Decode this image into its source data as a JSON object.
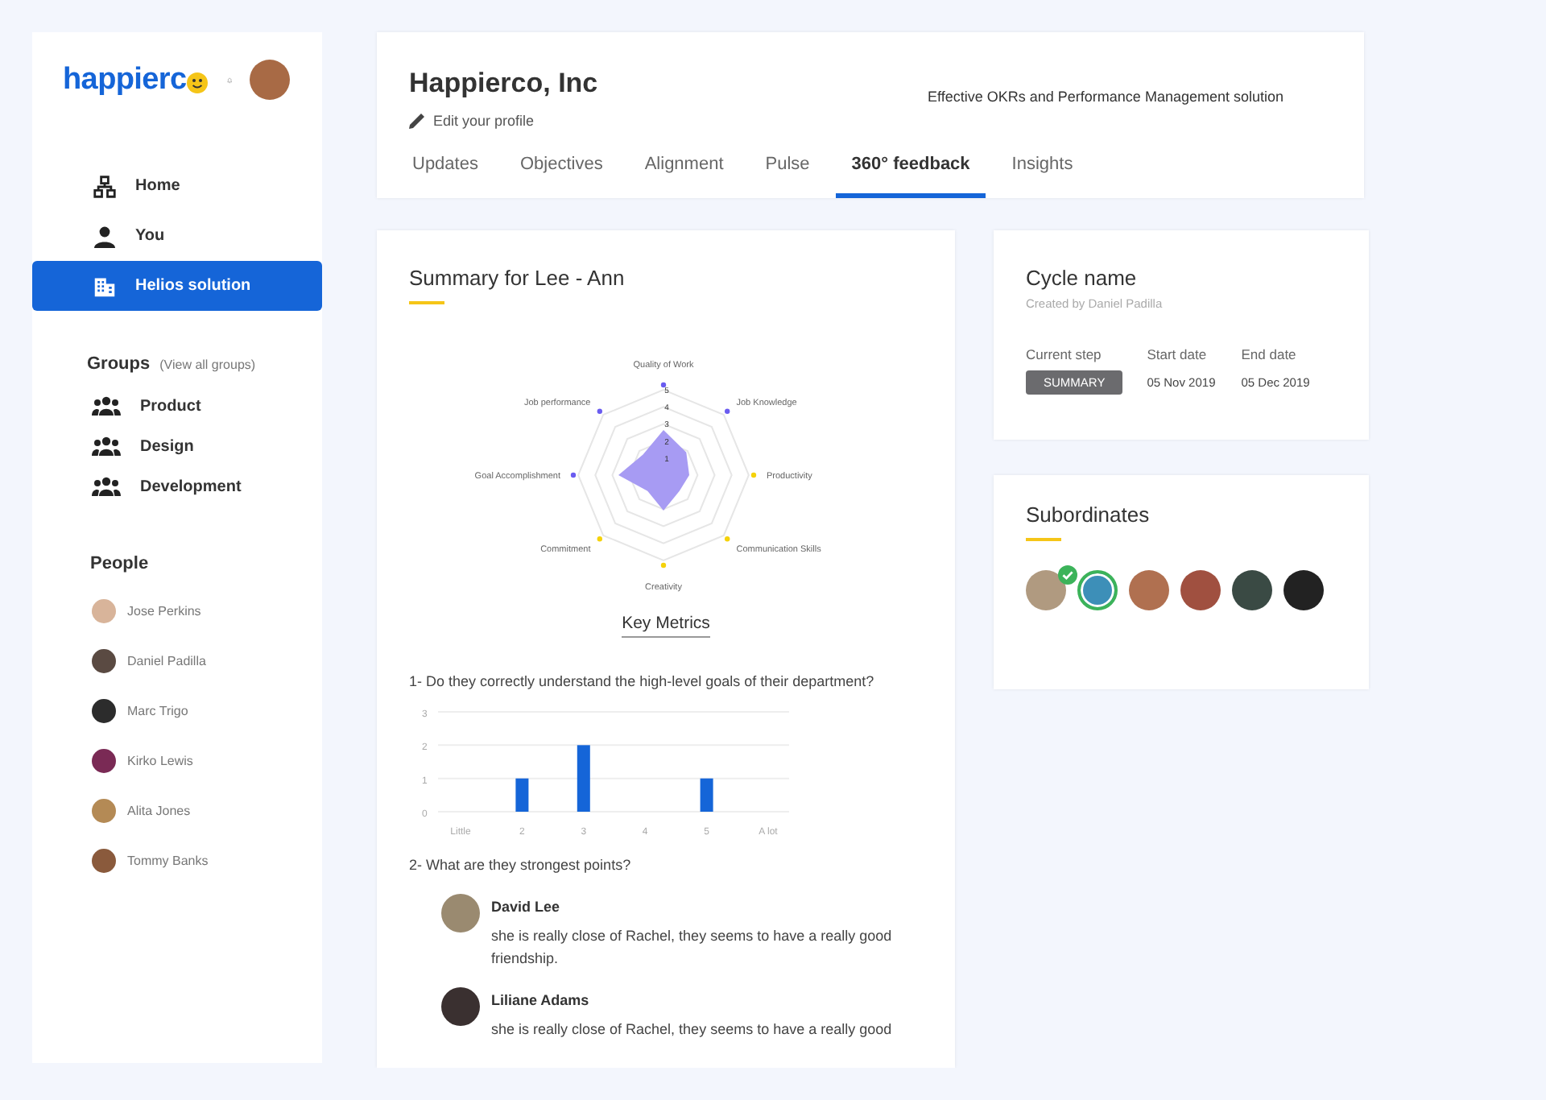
{
  "sidebar": {
    "logo": "happierc",
    "nav": [
      {
        "label": "Home",
        "selected": false
      },
      {
        "label": "You",
        "selected": false
      },
      {
        "label": "Helios solution",
        "selected": true
      }
    ],
    "groups_title": "Groups",
    "groups_link": "(View all groups)",
    "groups": [
      "Product",
      "Design",
      "Development"
    ],
    "people_title": "People",
    "people": [
      "Jose Perkins",
      "Daniel Padilla",
      "Marc Trigo",
      "Kirko Lewis",
      "Alita Jones",
      "Tommy Banks"
    ]
  },
  "header": {
    "company": "Happierco, Inc",
    "edit_link": "Edit your profile",
    "tagline": "Effective OKRs and Performance Management solution",
    "tabs": [
      {
        "label": "Updates",
        "selected": false
      },
      {
        "label": "Objectives",
        "selected": false
      },
      {
        "label": "Alignment",
        "selected": false
      },
      {
        "label": "Pulse",
        "selected": false
      },
      {
        "label": "360° feedback",
        "selected": true
      },
      {
        "label": "Insights",
        "selected": false
      }
    ]
  },
  "summary": {
    "title": "Summary for Lee - Ann",
    "radar": {
      "ticks": [
        "5",
        "4",
        "3",
        "2",
        "1"
      ],
      "axes": [
        {
          "label": "Quality of Work",
          "color": "#6a5cf0"
        },
        {
          "label": "Job Knowledge",
          "color": "#6a5cf0"
        },
        {
          "label": "Productivity",
          "color": "#f5d20a"
        },
        {
          "label": "Communication Skills",
          "color": "#f5d20a"
        },
        {
          "label": "Creativity",
          "color": "#f5d20a"
        },
        {
          "label": "Commitment",
          "color": "#f5d20a"
        },
        {
          "label": "Goal Accomplishment",
          "color": "#6a5cf0"
        },
        {
          "label": "Job performance",
          "color": "#6a5cf0"
        }
      ]
    },
    "metrics_title": "Key Metrics",
    "question_1": "1- Do they correctly understand the high-level goals of their department?",
    "chart_data": {
      "type": "bar",
      "categories": [
        "Little",
        "2",
        "3",
        "4",
        "5",
        "A lot"
      ],
      "series": [
        {
          "color": "#1565d8",
          "values": [
            null,
            1,
            2,
            0,
            1,
            null
          ]
        }
      ],
      "ylim": [
        0,
        3
      ],
      "yticks": [
        0,
        1,
        2,
        3
      ]
    },
    "question_2": "2- What are they strongest points?",
    "comments": [
      {
        "author": "David Lee",
        "text": "she is really close of Rachel, they seems to have a really good friendship."
      },
      {
        "author": "Liliane Adams",
        "text": "she is really close of Rachel, they seems to have a really good"
      }
    ]
  },
  "cycle": {
    "title": "Cycle name",
    "created_by": "Created by Daniel Padilla",
    "fields": [
      {
        "label": "Current step",
        "value": "SUMMARY",
        "kind": "badge"
      },
      {
        "label": "Start date",
        "value": "05 Nov 2019",
        "kind": "text"
      },
      {
        "label": "End date",
        "value": "05 Dec 2019",
        "kind": "text"
      }
    ]
  },
  "subordinates": {
    "title": "Subordinates",
    "people": [
      {
        "checked": true,
        "selected": false
      },
      {
        "checked": false,
        "selected": true
      },
      {
        "checked": false,
        "selected": false
      },
      {
        "checked": false,
        "selected": false
      },
      {
        "checked": false,
        "selected": false
      },
      {
        "checked": false,
        "selected": false
      }
    ]
  }
}
